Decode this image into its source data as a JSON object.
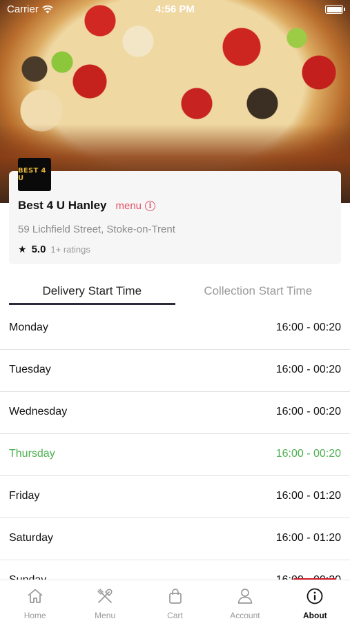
{
  "status_bar": {
    "carrier": "Carrier",
    "time": "4:56 PM"
  },
  "store": {
    "logo_text": "BEST 4 U",
    "name": "Best 4 U Hanley",
    "menu_link": "menu",
    "address": "59 Lichfield Street, Stoke-on-Trent",
    "rating": "5.0",
    "rating_count": "1+ ratings"
  },
  "tabs": [
    {
      "label": "Delivery Start Time",
      "active": true
    },
    {
      "label": "Collection Start Time",
      "active": false
    }
  ],
  "schedule": [
    {
      "day": "Monday",
      "hours": "16:00 - 00:20"
    },
    {
      "day": "Tuesday",
      "hours": "16:00 - 00:20"
    },
    {
      "day": "Wednesday",
      "hours": "16:00 - 00:20"
    },
    {
      "day": "Thursday",
      "hours": "16:00 - 00:20",
      "highlight": true
    },
    {
      "day": "Friday",
      "hours": "16:00 - 01:20"
    },
    {
      "day": "Saturday",
      "hours": "16:00 - 01:20"
    },
    {
      "day": "Sunday",
      "hours": "16:00 - 00:20"
    }
  ],
  "colors": {
    "accent_pink": "#e0556a",
    "today_green": "#4caf50",
    "tab_underline": "#2b2b3a"
  },
  "nav": [
    {
      "label": "Home",
      "icon": "home-icon"
    },
    {
      "label": "Menu",
      "icon": "cutlery-icon"
    },
    {
      "label": "Cart",
      "icon": "shopping-bag-icon"
    },
    {
      "label": "Account",
      "icon": "user-icon"
    },
    {
      "label": "About",
      "icon": "info-icon",
      "active": true
    }
  ]
}
